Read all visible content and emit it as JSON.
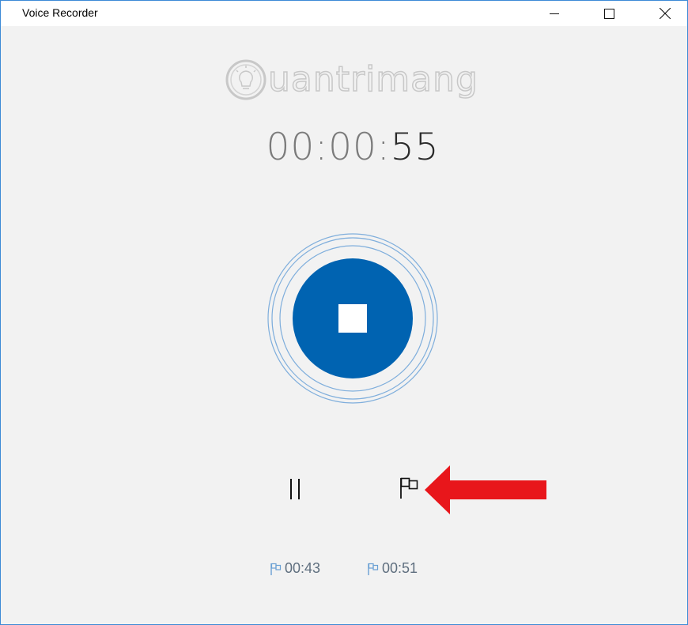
{
  "window": {
    "title": "Voice Recorder"
  },
  "watermark": {
    "text": "uantrimang"
  },
  "timer": {
    "dim_part": "00:00:",
    "bright_part": "55"
  },
  "markers": [
    {
      "time": "00:43"
    },
    {
      "time": "00:51"
    }
  ],
  "colors": {
    "accent": "#0063b1",
    "ring": "#5b9bd5",
    "arrow": "#e8161b",
    "window_border": "#3c8ad6",
    "background": "#f2f2f2"
  }
}
